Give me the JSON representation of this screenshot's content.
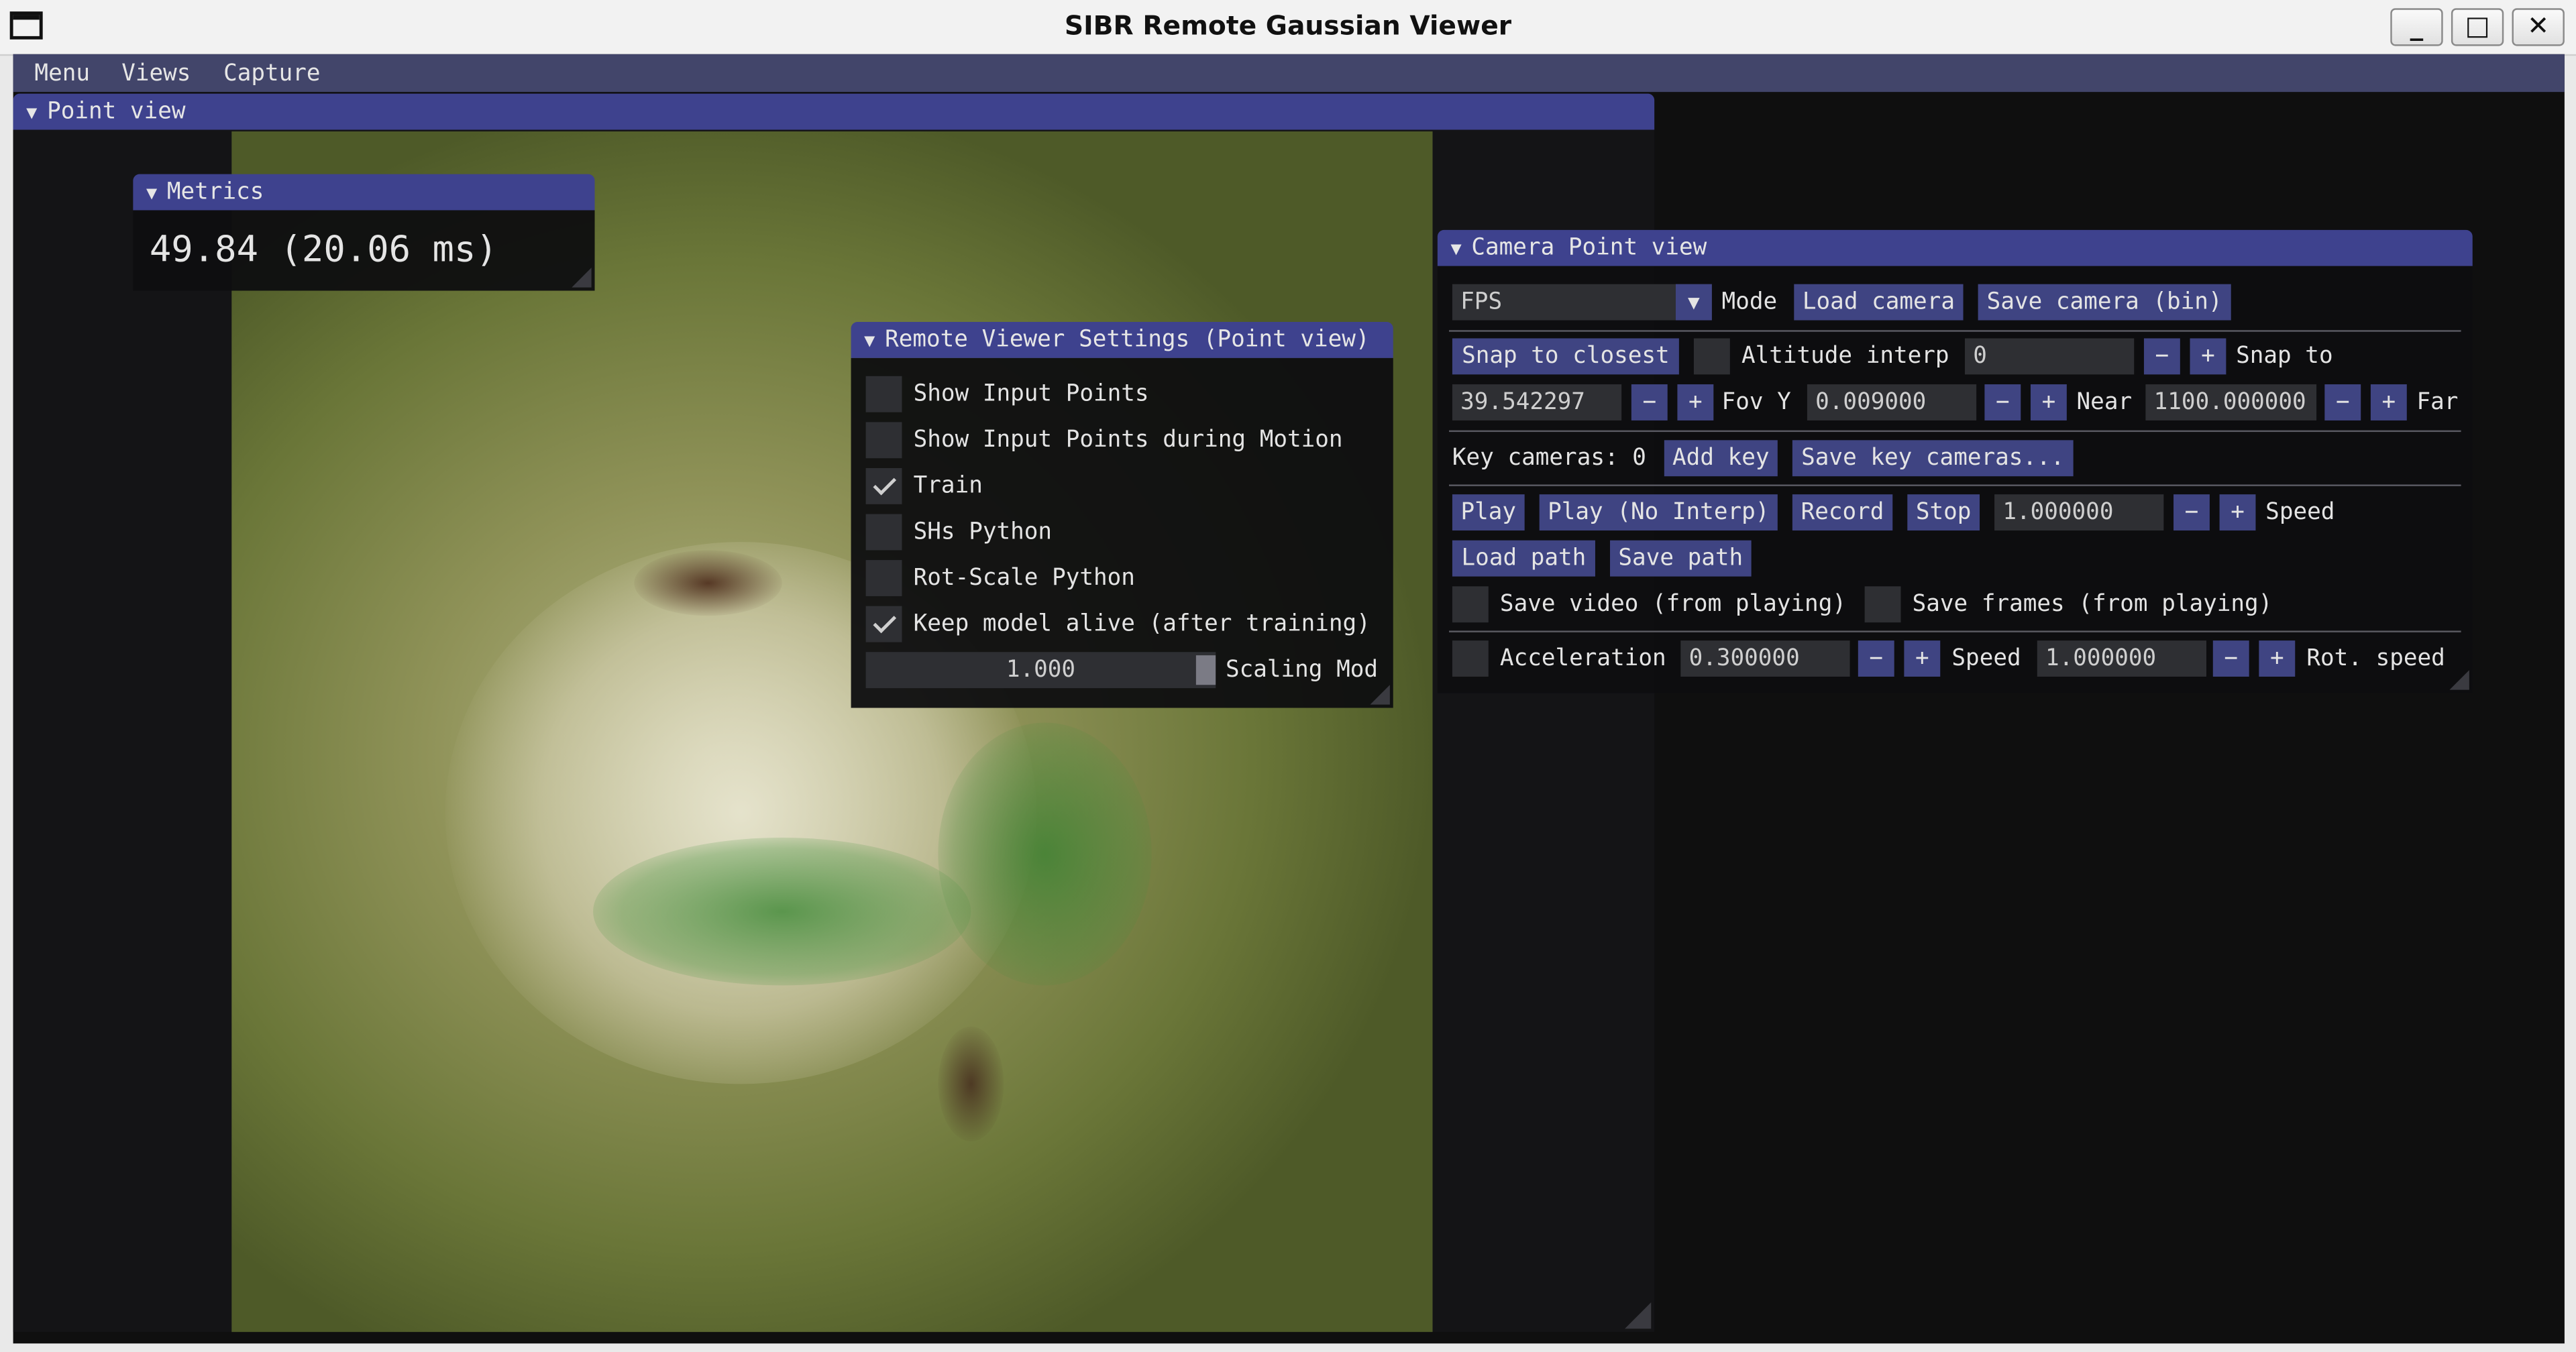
{
  "window": {
    "title": "SIBR Remote Gaussian Viewer",
    "minimize": "_",
    "maximize": "□",
    "close": "✕"
  },
  "menubar": {
    "items": [
      "Menu",
      "Views",
      "Capture"
    ]
  },
  "point_view": {
    "title": "Point view"
  },
  "metrics": {
    "title": "Metrics",
    "value": "49.84 (20.06 ms)"
  },
  "remote_settings": {
    "title": "Remote Viewer Settings (Point view)",
    "options": [
      {
        "label": "Show Input Points",
        "checked": false
      },
      {
        "label": "Show Input Points during Motion",
        "checked": false
      },
      {
        "label": "Train",
        "checked": true
      },
      {
        "label": "SHs Python",
        "checked": false
      },
      {
        "label": "Rot-Scale Python",
        "checked": false
      },
      {
        "label": "Keep model alive (after training)",
        "checked": true
      }
    ],
    "slider_value": "1.000",
    "slider_label": "Scaling Mod"
  },
  "camera": {
    "title": "Camera Point view",
    "mode_value": "FPS",
    "mode_label": "Mode",
    "load_camera": "Load camera",
    "save_camera": "Save camera (bin)",
    "snap_closest": "Snap to closest",
    "altitude_label": "Altitude interp",
    "altitude_value": "0",
    "snap_to": "Snap to",
    "fovy_value": "39.542297",
    "fovy_label": "Fov Y",
    "near_value": "0.009000",
    "near_label": "Near",
    "far_value": "1100.000000",
    "far_label": "Far",
    "key_cameras": "Key cameras: 0",
    "add_key": "Add key",
    "save_key_cameras": "Save key cameras...",
    "play": "Play",
    "play_no_interp": "Play (No Interp)",
    "record": "Record",
    "stop": "Stop",
    "speed_value": "1.000000",
    "speed_label": "Speed",
    "load_path": "Load path",
    "save_path": "Save path",
    "save_video": "Save video (from playing)",
    "save_frames": "Save frames (from playing)",
    "acceleration_label": "Acceleration",
    "acceleration_value": "0.300000",
    "speed2_label": "Speed",
    "rot_speed_value": "1.000000",
    "rot_speed_label": "Rot. speed",
    "minus": "−",
    "plus": "+"
  }
}
